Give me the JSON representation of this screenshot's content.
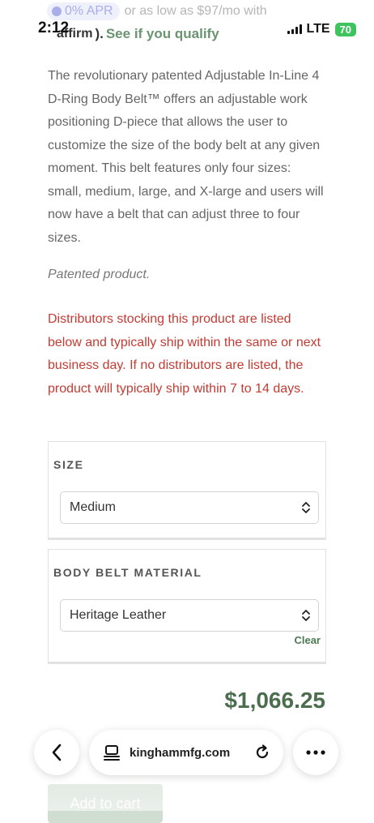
{
  "financing": {
    "apr_label": "0% APR",
    "monthly_text": "or as low as $97/mo with",
    "provider": "affirm",
    "cta": "See if you qualify"
  },
  "status_bar": {
    "time": "2:12",
    "network": "LTE",
    "battery": "70"
  },
  "product": {
    "description": "The revolutionary patented Adjustable In-Line 4 D-Ring Body Belt™ offers an adjustable work positioning D-piece that allows the user to customize the size of the body belt at any given moment. This belt features only four sizes: small, medium, large, and X-large and users will now have a belt that can adjust three to four sizes.",
    "patented_note": "Patented product.",
    "distributor_note": "Distributors stocking this product are listed below and typically ship within the same or next business day. If no distributors are listed, the product will typically ship within 7 to 14 days.",
    "price": "$1,066.25"
  },
  "options": {
    "size": {
      "label": "SIZE",
      "selected": "Medium"
    },
    "material": {
      "label": "BODY BELT MATERIAL",
      "selected": "Heritage Leather",
      "clear_label": "Clear"
    }
  },
  "browser": {
    "url": "kinghammfg.com"
  },
  "cart": {
    "add_label": "Add to cart"
  },
  "colors": {
    "accent_green": "#4b6e4e",
    "warning_red": "#c33b33"
  }
}
